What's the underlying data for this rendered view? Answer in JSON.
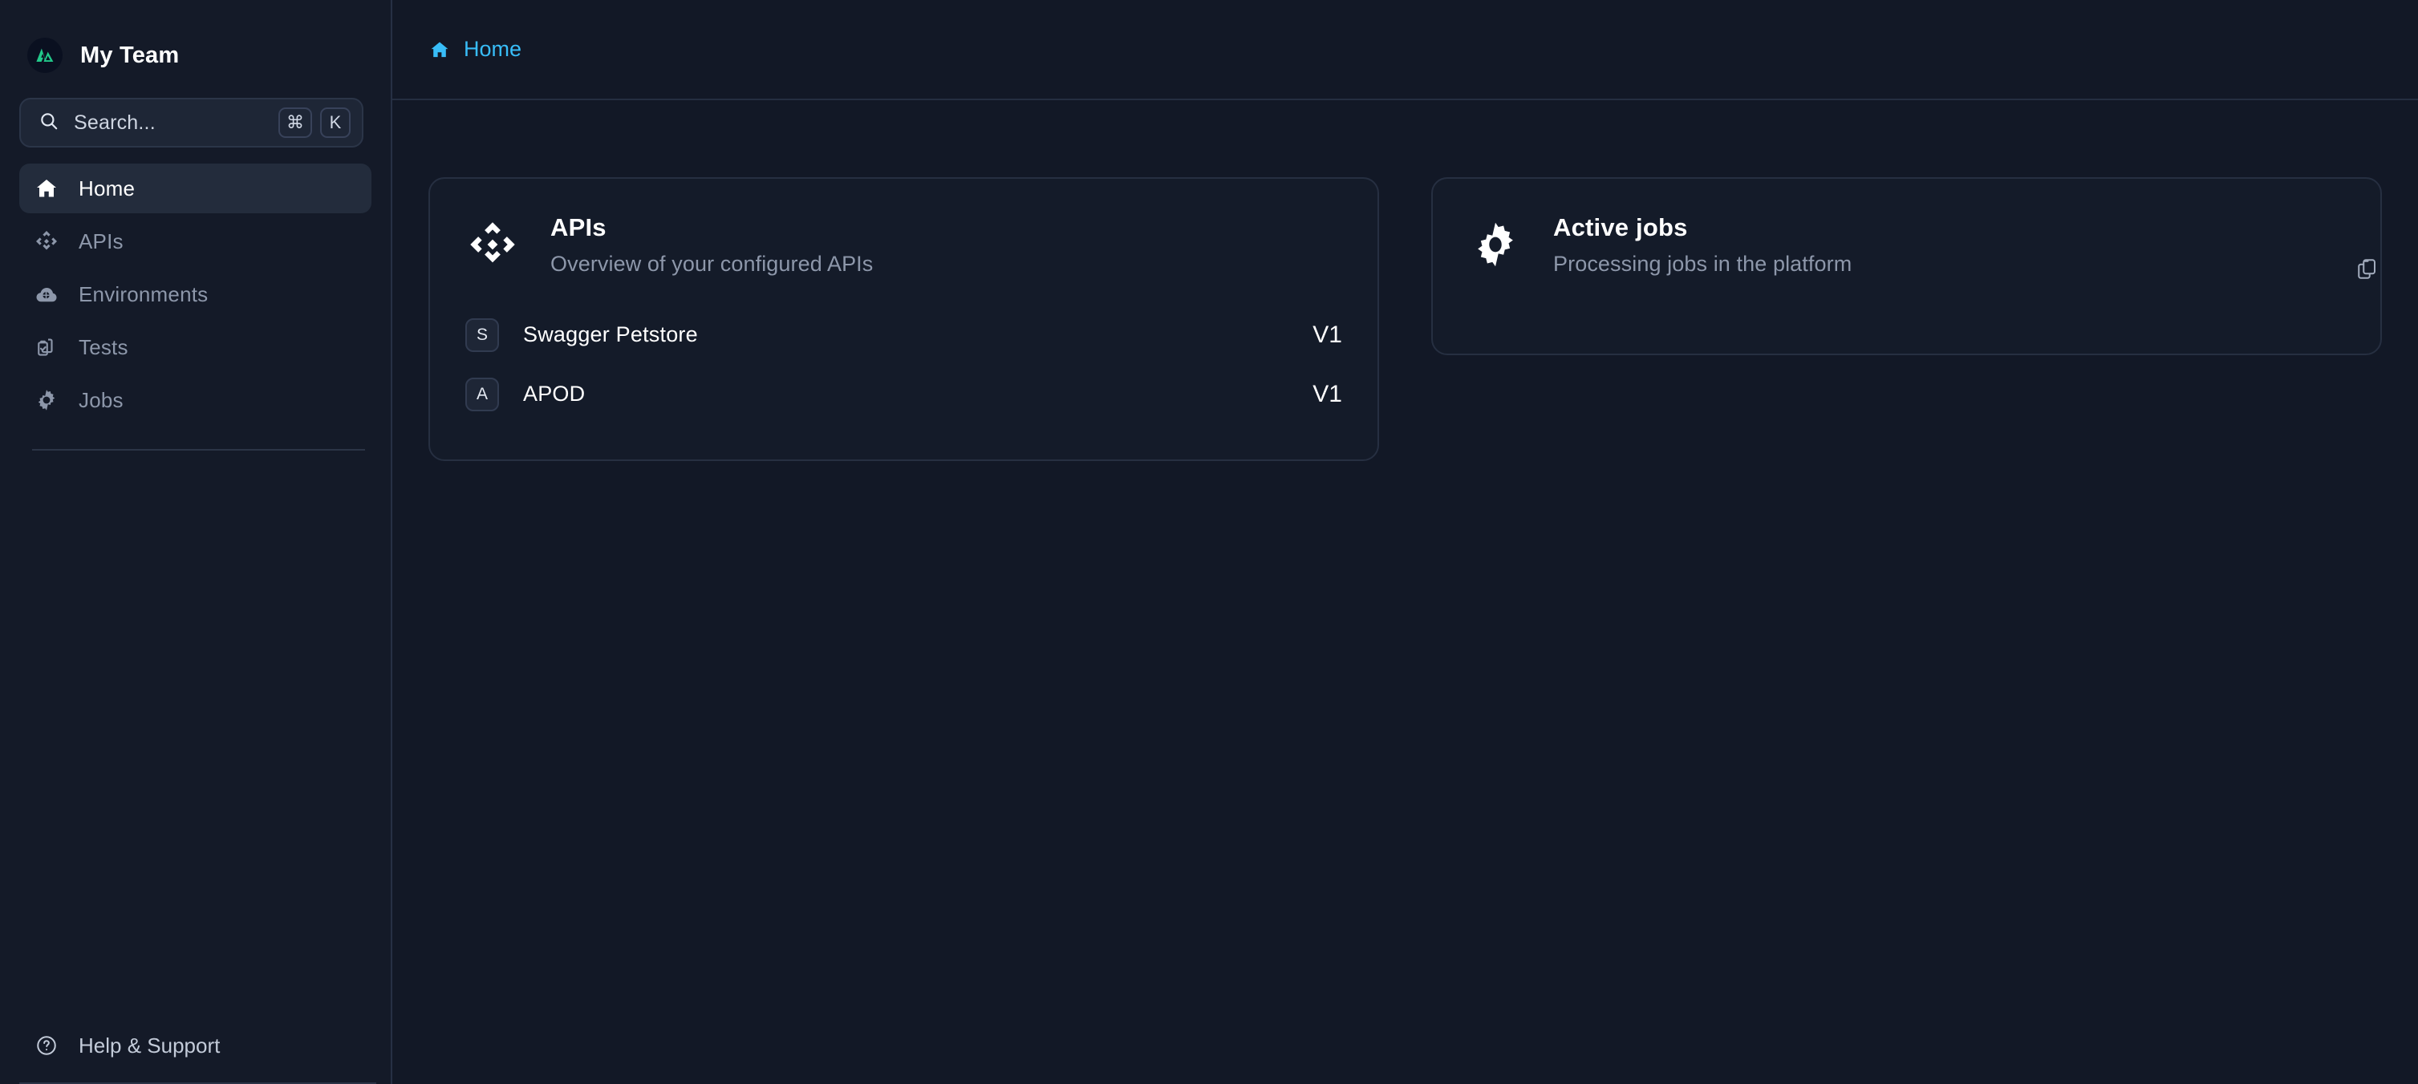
{
  "sidebar": {
    "brand": {
      "name": "My Team",
      "logo_icon": "mountain-logo-icon",
      "logo_color": "#22c98a"
    },
    "search": {
      "placeholder": "Search...",
      "icon": "search-icon",
      "shortcut_keys": [
        "⌘",
        "K"
      ]
    },
    "items": [
      {
        "label": "Home",
        "icon": "home-icon",
        "active": true
      },
      {
        "label": "APIs",
        "icon": "apis-diamond-icon",
        "active": false
      },
      {
        "label": "Environments",
        "icon": "cloud-environments-icon",
        "active": false
      },
      {
        "label": "Tests",
        "icon": "clipboard-check-icon",
        "active": false
      },
      {
        "label": "Jobs",
        "icon": "gear-icon",
        "active": false
      }
    ],
    "help": {
      "label": "Help & Support",
      "icon": "question-circle-icon"
    }
  },
  "topbar": {
    "breadcrumb": {
      "label": "Home",
      "icon": "home-icon",
      "color": "#38bdf8"
    }
  },
  "content": {
    "copy_button": {
      "icon": "copy-clipboard-icon"
    },
    "cards": [
      {
        "icon": "apis-diamond-icon",
        "title": "APIs",
        "subtitle": "Overview of your configured APIs",
        "rows": [
          {
            "badge": "S",
            "name": "Swagger Petstore",
            "version": "V1"
          },
          {
            "badge": "A",
            "name": "APOD",
            "version": "V1"
          }
        ]
      },
      {
        "icon": "gear-icon",
        "title": "Active jobs",
        "subtitle": "Processing jobs in the platform",
        "rows": []
      }
    ]
  },
  "theme": {
    "background": "#121826",
    "sidebar_background": "#141a28",
    "card_background": "#141b29",
    "border": "#262f41",
    "accent": "#38bdf8",
    "brand_green": "#22c98a",
    "text_primary": "#ffffff",
    "text_muted": "#8d97aa"
  }
}
